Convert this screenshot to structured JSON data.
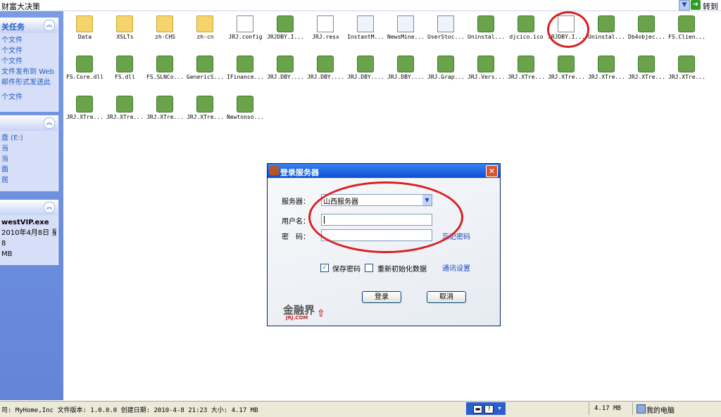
{
  "address": {
    "text": "财富大决策",
    "go_label": "转到"
  },
  "sidebar": {
    "panels": [
      {
        "title": "关任务",
        "items": [
          "个文件",
          "个文件",
          "个文件",
          "文件发布到 Web",
          "邮件形式发送此",
          "个文件"
        ]
      },
      {
        "title": "",
        "items": [
          "盘 (E:)",
          "当",
          "当",
          "面",
          "居"
        ]
      },
      {
        "title": "",
        "items": [
          "westVIP.exe",
          "2010年4月8日 星",
          "8",
          "MB"
        ]
      }
    ]
  },
  "files": [
    "Data",
    "XSLTs",
    "zh-CHS",
    "zh-cn",
    "JRJ.config",
    "JRJDBY.I...",
    "JRJ.resx",
    "InstantM...",
    "NewsMine...",
    "UserStoc...",
    "Uninstal...",
    "djcico.ico",
    "JRJDBY.I...",
    "Uninstal...",
    "Db4objec...",
    "FS.Clien...",
    "FS.Core.dll",
    "FS.dll",
    "FS.SLNCo...",
    "GenericS...",
    "IFinance...",
    "JRJ.DBY....",
    "JRJ.DBY....",
    "JRJ.DBY....",
    "JRJ.DBY....",
    "JRJ.Grap...",
    "JRJ.Vers...",
    "JRJ.XTre...",
    "JRJ.XTre...",
    "JRJ.XTre...",
    "JRJ.XTre...",
    "JRJ.XTre...",
    "JRJ.XTre...",
    "JRJ.XTre...",
    "JRJ.XTre...",
    "JRJ.XTre...",
    "Newtonso..."
  ],
  "dialog": {
    "title": "登录服务器",
    "server_label": "服务器：",
    "server_value": "山西服务器",
    "user_label": "用户名：",
    "user_value": "",
    "password_label": "密　码：",
    "password_value": "",
    "forgot_link": "忘记密码",
    "save_password_label": "保存密码",
    "save_password_checked": true,
    "reinit_label": "重新初始化数据",
    "reinit_checked": false,
    "comm_settings_link": "通讯设置",
    "login_button": "登录",
    "cancel_button": "取消",
    "logo_text": "金融界",
    "logo_sub": "JRJ.COM"
  },
  "statusbar": {
    "text": "司: MyHome,Inc 文件版本: 1.0.0.0 创建日期: 2010-4-8 21:23 大小: 4.17 MB",
    "size": "4.17 MB",
    "location": "我的电脑"
  }
}
